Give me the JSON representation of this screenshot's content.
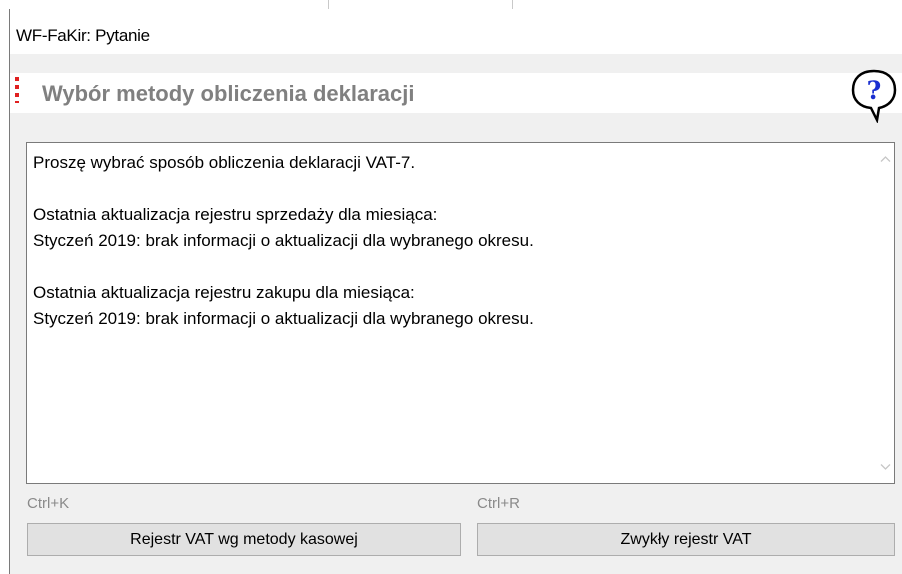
{
  "window": {
    "title": "WF-FaKir: Pytanie"
  },
  "header": {
    "title": "Wybór metody obliczenia deklaracji",
    "help_icon": "question-bubble-icon"
  },
  "message": {
    "lines": [
      "Proszę wybrać sposób obliczenia deklaracji VAT-7.",
      "",
      "Ostatnia aktualizacja rejestru sprzedaży dla miesiąca:",
      "Styczeń 2019: brak informacji o aktualizacji dla wybranego okresu.",
      "",
      "Ostatnia aktualizacja rejestru zakupu dla miesiąca:",
      "Styczeń 2019: brak informacji o aktualizacji dla wybranego okresu."
    ]
  },
  "buttons": {
    "cash": {
      "shortcut": "Ctrl+K",
      "label": "Rejestr VAT wg metody kasowej"
    },
    "regular": {
      "shortcut": "Ctrl+R",
      "label": "Zwykły rejestr VAT"
    }
  },
  "colors": {
    "accent_marker": "#e02020",
    "help_icon_blue": "#1a2fd0"
  }
}
